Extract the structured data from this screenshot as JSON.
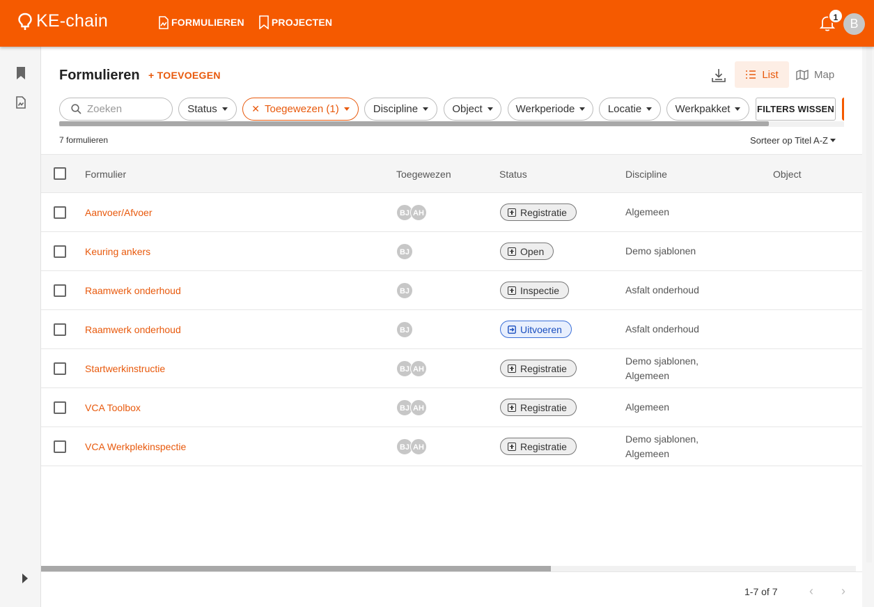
{
  "app": {
    "name": "KE-chain"
  },
  "nav": [
    {
      "label": "FORMULIEREN",
      "icon": "form-document-icon"
    },
    {
      "label": "PROJECTEN",
      "icon": "bookmark-icon"
    }
  ],
  "notifications": {
    "count": "1"
  },
  "user": {
    "initial": "B"
  },
  "page": {
    "title": "Formulieren",
    "add_label": "+ TOEVOEGEN",
    "view_list_label": "List",
    "view_map_label": "Map"
  },
  "search": {
    "placeholder": "Zoeken"
  },
  "filters": [
    {
      "label": "Status"
    },
    {
      "label": "Toegewezen (1)"
    },
    {
      "label": "Discipline"
    },
    {
      "label": "Object"
    },
    {
      "label": "Werkperiode"
    },
    {
      "label": "Locatie"
    },
    {
      "label": "Werkpakket"
    }
  ],
  "clear_filters_label": "FILTERS WISSEN",
  "count_label": "7 formulieren",
  "sort_label": "Sorteer op Titel A-Z",
  "columns": [
    "Formulier",
    "Toegewezen",
    "Status",
    "Discipline",
    "Object"
  ],
  "rows": [
    {
      "title": "Aanvoer/Afvoer",
      "users": [
        "BJ",
        "AH"
      ],
      "status": "Registratie",
      "discipline": [
        "Algemeen"
      ]
    },
    {
      "title": "Keuring ankers",
      "users": [
        "BJ"
      ],
      "status": "Open",
      "discipline": [
        "Demo sjablonen"
      ]
    },
    {
      "title": "Raamwerk onderhoud",
      "users": [
        "BJ"
      ],
      "status": "Inspectie",
      "discipline": [
        "Asfalt onderhoud"
      ]
    },
    {
      "title": "Raamwerk onderhoud",
      "users": [
        "BJ"
      ],
      "status": "Uitvoeren",
      "discipline": [
        "Asfalt onderhoud"
      ]
    },
    {
      "title": "Startwerkinstructie",
      "users": [
        "BJ",
        "AH"
      ],
      "status": "Registratie",
      "discipline": [
        "Demo sjablonen,",
        "Algemeen"
      ]
    },
    {
      "title": "VCA Toolbox",
      "users": [
        "BJ",
        "AH"
      ],
      "status": "Registratie",
      "discipline": [
        "Algemeen"
      ]
    },
    {
      "title": "VCA Werkplekinspectie",
      "users": [
        "BJ",
        "AH"
      ],
      "status": "Registratie",
      "discipline": [
        "Demo sjablonen,",
        "Algemeen"
      ]
    }
  ],
  "pagination": {
    "label": "1-7 of 7",
    "prev": "‹",
    "next": "›"
  },
  "colors": {
    "brand": "#f55a00",
    "accent": "#e8590c",
    "status_active": "#3a6fd8"
  }
}
